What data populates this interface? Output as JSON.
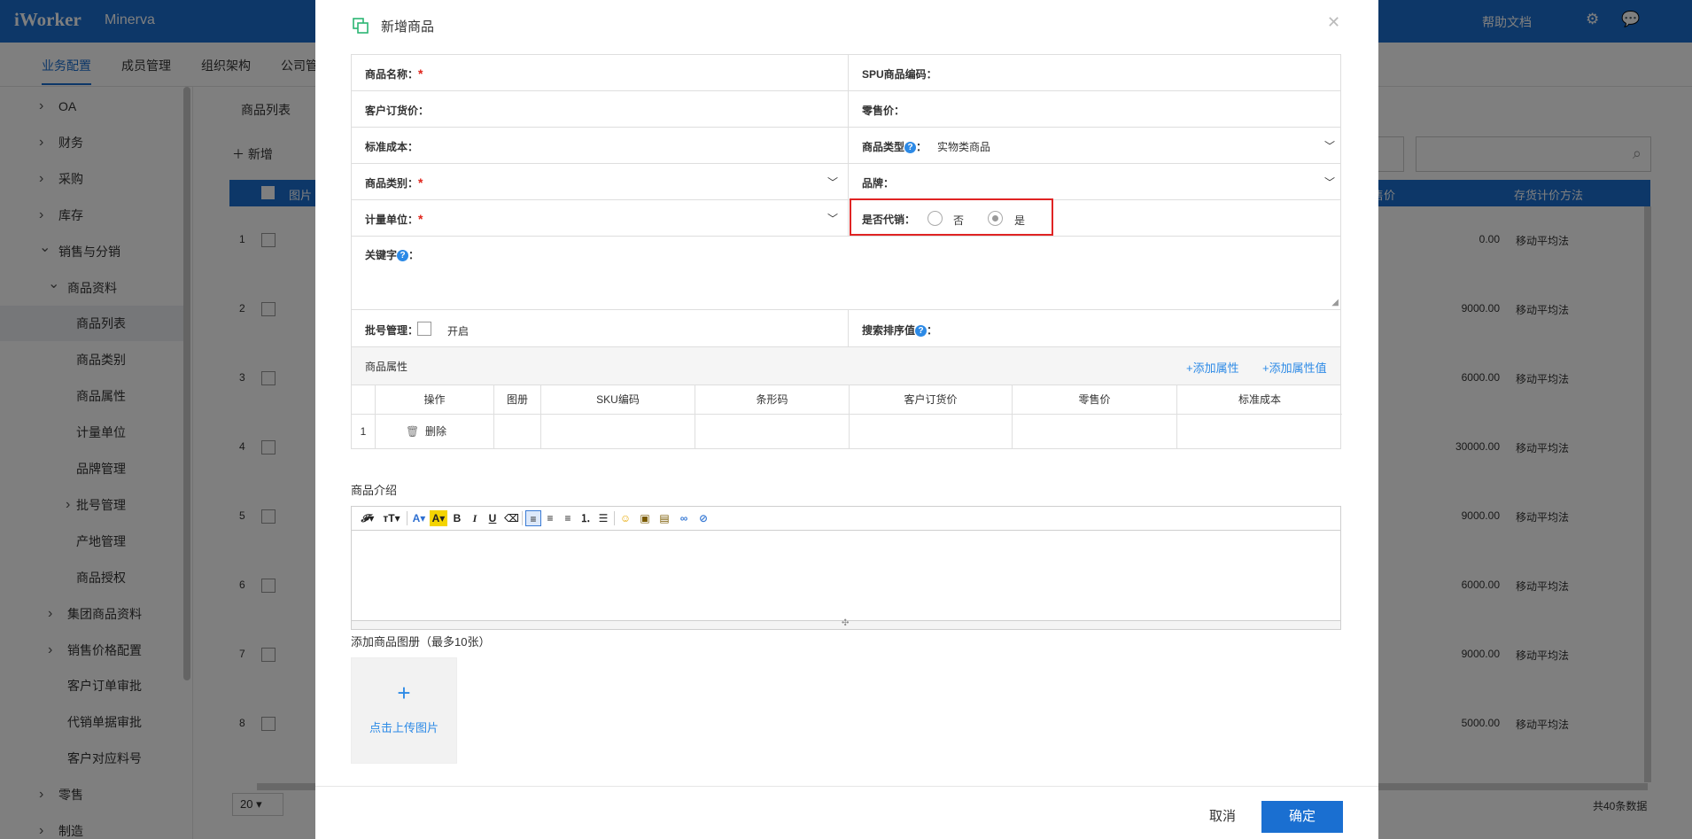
{
  "topbar": {
    "logo": "iWorker",
    "app": "Minerva",
    "help": "帮助文档"
  },
  "navtabs": [
    "业务配置",
    "成员管理",
    "组织架构",
    "公司管"
  ],
  "sidebar": {
    "items": [
      {
        "label": "OA",
        "arrow": "›"
      },
      {
        "label": "财务",
        "arrow": "›"
      },
      {
        "label": "采购",
        "arrow": "›"
      },
      {
        "label": "库存",
        "arrow": "›"
      },
      {
        "label": "销售与分销",
        "arrow": "⌄"
      },
      {
        "label": "商品资料",
        "arrow": "⌄"
      },
      {
        "label": "商品列表"
      },
      {
        "label": "商品类别"
      },
      {
        "label": "商品属性"
      },
      {
        "label": "计量单位"
      },
      {
        "label": "品牌管理"
      },
      {
        "label": "批号管理",
        "arrow": "›"
      },
      {
        "label": "产地管理"
      },
      {
        "label": "商品授权"
      },
      {
        "label": "集团商品资料",
        "arrow": "›"
      },
      {
        "label": "销售价格配置",
        "arrow": "›"
      },
      {
        "label": "客户订单审批"
      },
      {
        "label": "代销单据审批"
      },
      {
        "label": "客户对应料号"
      },
      {
        "label": "零售",
        "arrow": "›"
      },
      {
        "label": "制造",
        "arrow": "›"
      }
    ]
  },
  "main": {
    "tab": "商品列表",
    "new_label": "新增",
    "col_image": "图片",
    "col_price": "售价",
    "col_method": "存货计价方法",
    "rows": [
      {
        "num": "1",
        "price": "0.00",
        "method": "移动平均法"
      },
      {
        "num": "2",
        "price": "9000.00",
        "method": "移动平均法"
      },
      {
        "num": "3",
        "price": "6000.00",
        "method": "移动平均法"
      },
      {
        "num": "4",
        "price": "30000.00",
        "method": "移动平均法"
      },
      {
        "num": "5",
        "price": "9000.00",
        "method": "移动平均法"
      },
      {
        "num": "6",
        "price": "6000.00",
        "method": "移动平均法"
      },
      {
        "num": "7",
        "price": "9000.00",
        "method": "移动平均法"
      },
      {
        "num": "8",
        "price": "5000.00",
        "method": "移动平均法"
      }
    ],
    "page_size": "20",
    "total": "共40条数据"
  },
  "dialog": {
    "title": "新增商品",
    "fields": {
      "name": "商品名称：",
      "spu": "SPU商品编码：",
      "order_price": "客户订货价：",
      "retail_price": "零售价：",
      "std_cost": "标准成本：",
      "type": "商品类型",
      "type_value": "实物类商品",
      "category": "商品类别：",
      "brand": "品牌：",
      "unit": "计量单位：",
      "consign": "是否代销：",
      "consign_no": "否",
      "consign_yes": "是",
      "keyword": "关键字",
      "batch": "批号管理：",
      "batch_on": "开启",
      "search_sort": "搜索排序值"
    },
    "attr": {
      "title": "商品属性",
      "add_attr": "+添加属性",
      "add_attr_value": "+添加属性值",
      "headers": [
        "操作",
        "图册",
        "SKU编码",
        "条形码",
        "客户订货价",
        "零售价",
        "标准成本"
      ],
      "row_num": "1",
      "delete": "删除"
    },
    "intro_label": "商品介绍",
    "album_label": "添加商品图册（最多10张）",
    "upload_text": "点击上传图片",
    "cancel": "取消",
    "ok": "确定"
  }
}
